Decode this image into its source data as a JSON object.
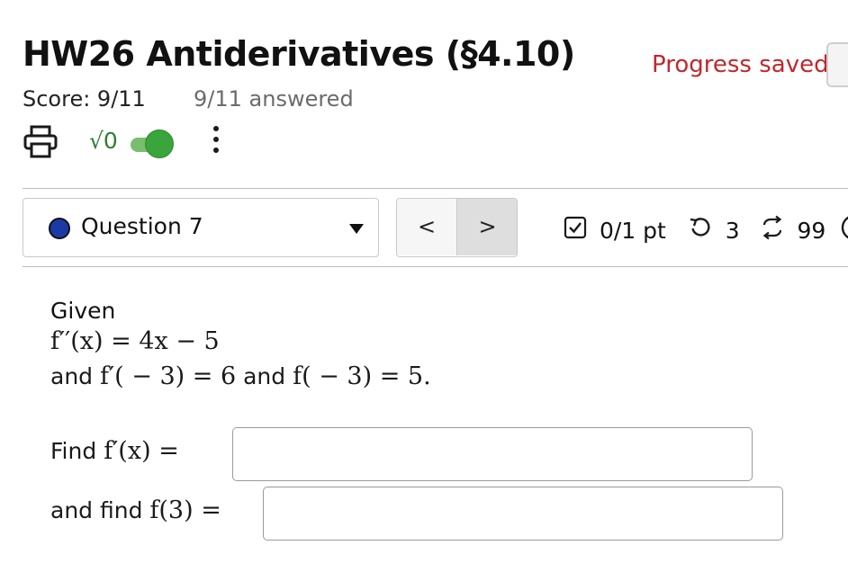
{
  "header": {
    "title": "HW26 Antiderivatives (§4.10)",
    "progress_status": "Progress saved",
    "score": "Score: 9/11",
    "answered": "9/11 answered",
    "toolbar": {
      "print_icon": "printer-icon",
      "math_toggle_label": "√0",
      "math_toggle_on": true,
      "more_icon": "kebab-menu-icon"
    }
  },
  "question_nav": {
    "selected_question": "Question 7",
    "status_color": "#1c3aa6",
    "prev_label": "<",
    "next_label": ">"
  },
  "question_meta": {
    "points": "0/1 pt",
    "retries": "3",
    "attempts": "99",
    "info_icon": "info-icon"
  },
  "problem": {
    "given_label": "Given",
    "equation_fpp": "f′′(x) = 4x − 5",
    "and_word": "and",
    "cond1": "f′( − 3) = 6",
    "cond2": "f( − 3) = 5.",
    "find1_prefix": "Find",
    "find1_expr": "f′(x) =",
    "find2_prefix": "and find",
    "find2_expr": "f(3) ="
  },
  "answers": {
    "fprime_value": "",
    "f3_value": ""
  },
  "colors": {
    "progress_text": "#c0282d",
    "toggle_on": "#3aa53a",
    "math_green": "#2e7d32"
  }
}
